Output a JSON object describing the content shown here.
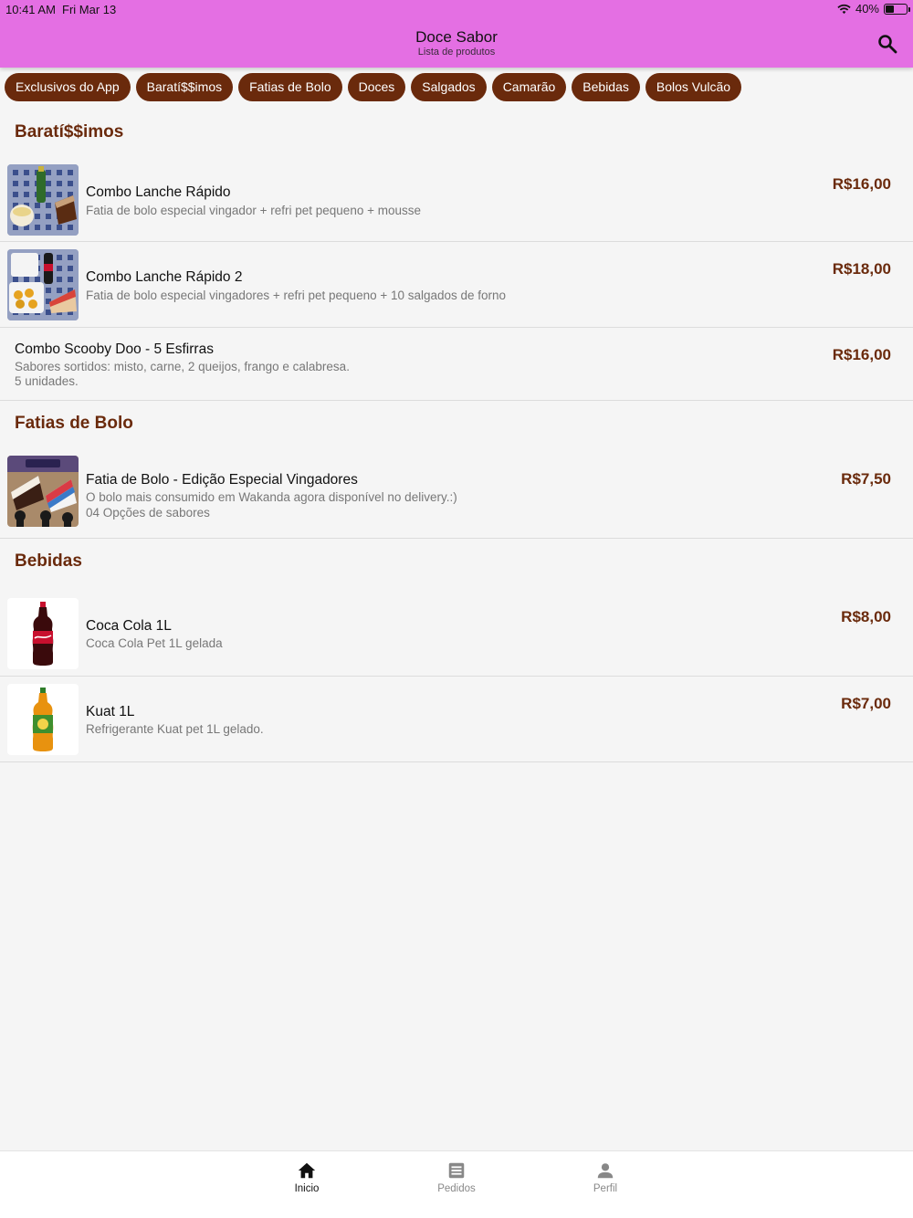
{
  "status": {
    "time": "10:41 AM",
    "date": "Fri Mar 13",
    "battery": "40%",
    "battery_level": 0.4
  },
  "header": {
    "title": "Doce Sabor",
    "subtitle": "Lista de produtos",
    "search_icon": "search-icon"
  },
  "categories": [
    "Exclusivos do App",
    "Baratí$$imos",
    "Fatias de Bolo",
    "Doces",
    "Salgados",
    "Camarão",
    "Bebidas",
    "Bolos Vulcão"
  ],
  "sections": [
    {
      "title": "Baratí$$imos",
      "items": [
        {
          "name": "Combo Lanche Rápido",
          "desc1": "Fatia de bolo especial vingador + refri pet pequeno + mousse",
          "desc2": "",
          "price": "R$16,00"
        },
        {
          "name": "Combo Lanche Rápido 2",
          "desc1": "Fatia de bolo especial vingadores + refri pet pequeno + 10 salgados de forno",
          "desc2": "",
          "price": "R$18,00"
        },
        {
          "name": "Combo Scooby Doo - 5 Esfirras",
          "desc1": "Sabores sortidos: misto, carne, 2 queijos, frango e calabresa.",
          "desc2": "5 unidades.",
          "price": "R$16,00"
        }
      ]
    },
    {
      "title": "Fatias de Bolo",
      "items": [
        {
          "name": "Fatia de Bolo - Edição Especial Vingadores",
          "desc1": "O bolo mais consumido em Wakanda agora disponível no delivery.:)",
          "desc2": "04 Opções de sabores",
          "price": "R$7,50"
        }
      ]
    },
    {
      "title": "Bebidas",
      "items": [
        {
          "name": "Coca Cola 1L",
          "desc1": "Coca Cola Pet 1L gelada",
          "desc2": "",
          "price": "R$8,00"
        },
        {
          "name": "Kuat 1L",
          "desc1": "Refrigerante Kuat pet 1L gelado.",
          "desc2": "",
          "price": "R$7,00"
        }
      ]
    }
  ],
  "nav": [
    {
      "label": "Inicio",
      "icon": "home-icon",
      "active": true
    },
    {
      "label": "Pedidos",
      "icon": "orders-icon",
      "active": false
    },
    {
      "label": "Perfil",
      "icon": "profile-icon",
      "active": false
    }
  ],
  "colors": {
    "header": "#e46fe3",
    "brand_brown": "#6a2a0c",
    "background": "#f5f5f5"
  }
}
